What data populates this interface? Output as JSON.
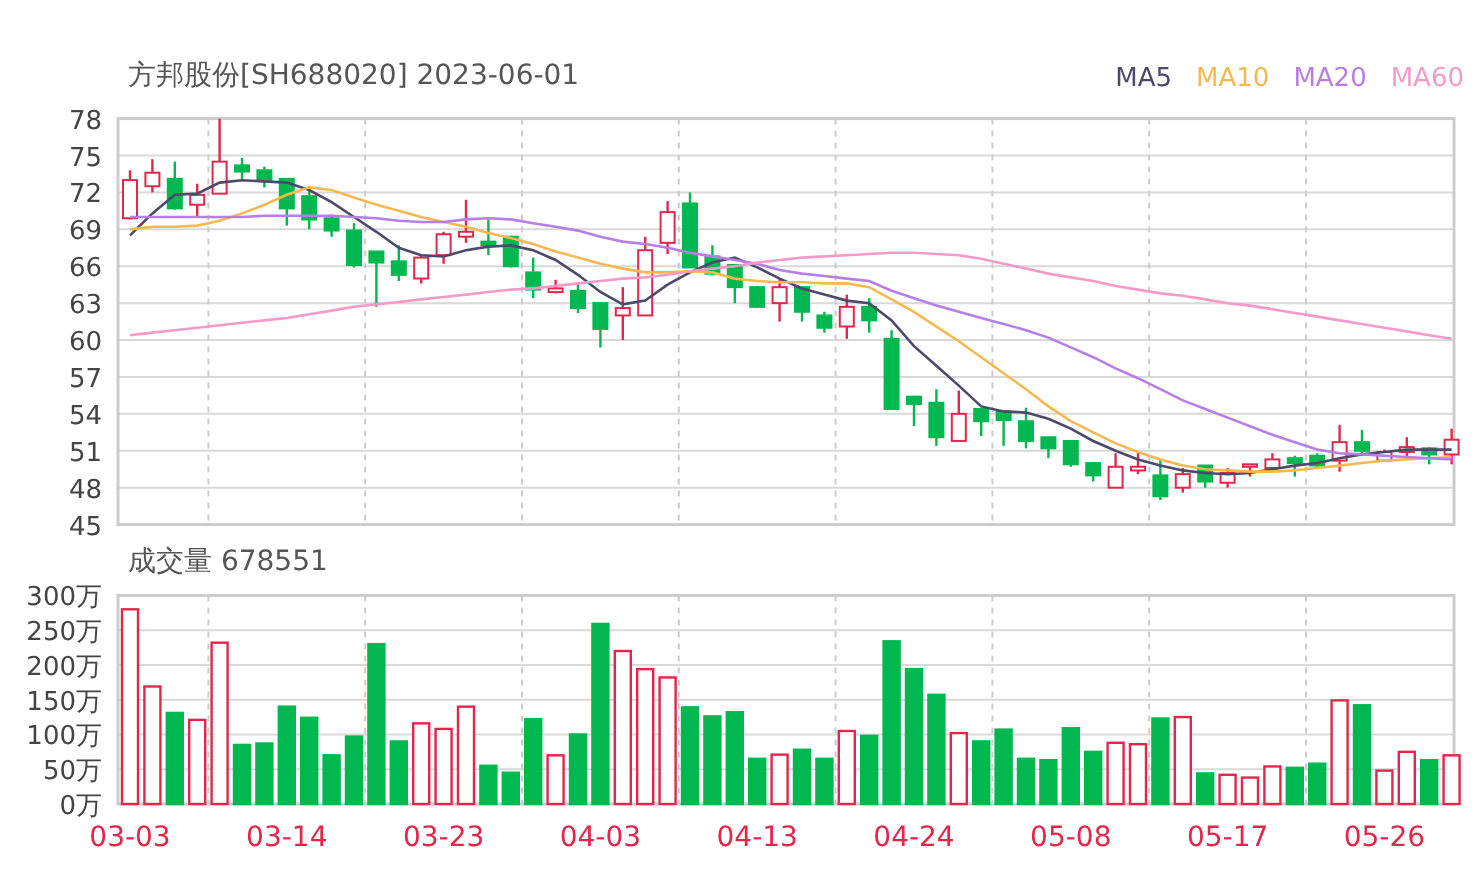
{
  "title": "方邦股份[SH688020] 2023-06-01",
  "price_chart": {
    "chart_data": {
      "type": "candlestick",
      "grid": true,
      "ylim": [
        45,
        78
      ],
      "yticks": [
        45,
        48,
        51,
        54,
        57,
        60,
        63,
        66,
        69,
        72,
        75,
        78
      ],
      "categories": [
        null,
        null,
        null,
        null,
        null,
        null,
        null,
        null,
        null,
        null,
        null,
        null,
        null,
        null,
        null,
        null,
        null,
        null,
        null,
        null,
        null,
        null,
        null,
        null,
        null,
        null,
        null,
        null,
        null,
        null,
        null,
        null,
        null,
        null,
        null,
        null,
        null,
        null,
        null,
        null,
        null,
        null,
        null,
        null,
        null,
        null,
        null,
        null,
        null,
        null,
        null,
        null,
        null,
        null,
        null,
        null,
        null,
        null,
        null,
        null
      ],
      "series": [
        {
          "name": "MA5",
          "type": "line",
          "color": "#4b4a6b",
          "values": [
            68.5,
            70.3,
            71.8,
            71.9,
            72.8,
            73.0,
            72.9,
            72.8,
            72.2,
            71.2,
            70.0,
            68.8,
            67.5,
            66.9,
            66.8,
            67.3,
            67.6,
            67.7,
            67.3,
            66.5,
            65.3,
            63.9,
            62.9,
            63.2,
            64.5,
            65.5,
            66.3,
            66.7,
            65.9,
            65.0,
            64.2,
            63.7,
            63.2,
            63.0,
            61.6,
            59.5,
            57.9,
            56.3,
            54.6,
            54.2,
            54.1,
            53.6,
            52.8,
            51.8,
            51.0,
            50.3,
            49.8,
            49.4,
            49.2,
            49.1,
            49.2,
            49.5,
            49.8,
            50.0,
            50.4,
            50.7,
            50.9,
            51.1,
            51.1,
            51.1
          ]
        },
        {
          "name": "MA10",
          "type": "line",
          "color": "#f5b94f",
          "values": [
            69.0,
            69.2,
            69.2,
            69.3,
            69.7,
            70.3,
            71.0,
            71.8,
            72.4,
            72.2,
            71.6,
            71.0,
            70.5,
            70.0,
            69.6,
            69.2,
            68.7,
            68.3,
            67.8,
            67.2,
            66.7,
            66.2,
            65.8,
            65.5,
            65.5,
            65.6,
            65.5,
            65.0,
            64.8,
            64.7,
            64.7,
            64.6,
            64.6,
            64.3,
            63.3,
            62.3,
            61.1,
            59.9,
            58.6,
            57.3,
            56.0,
            54.6,
            53.4,
            52.5,
            51.6,
            50.9,
            50.3,
            49.8,
            49.5,
            49.4,
            49.3,
            49.3,
            49.4,
            49.6,
            49.8,
            50.0,
            50.2,
            50.3,
            50.4,
            50.5
          ]
        },
        {
          "name": "MA20",
          "type": "line",
          "color": "#b77ee6",
          "values": [
            70.0,
            70.0,
            70.0,
            70.0,
            70.0,
            70.0,
            70.1,
            70.1,
            70.1,
            70.1,
            70.0,
            69.9,
            69.7,
            69.6,
            69.6,
            69.8,
            69.9,
            69.8,
            69.5,
            69.2,
            68.9,
            68.4,
            68.0,
            67.8,
            67.5,
            67.1,
            66.8,
            66.5,
            66.2,
            65.7,
            65.4,
            65.2,
            65.0,
            64.8,
            64.0,
            63.4,
            62.8,
            62.3,
            61.8,
            61.3,
            60.8,
            60.2,
            59.4,
            58.6,
            57.7,
            56.9,
            56.0,
            55.1,
            54.4,
            53.7,
            53.0,
            52.3,
            51.7,
            51.1,
            50.8,
            50.7,
            50.6,
            50.5,
            50.4,
            50.3
          ]
        },
        {
          "name": "MA60",
          "type": "line",
          "color": "#f59ac8",
          "values": [
            60.4,
            60.6,
            60.8,
            61.0,
            61.2,
            61.4,
            61.6,
            61.8,
            62.1,
            62.4,
            62.7,
            62.9,
            63.1,
            63.3,
            63.5,
            63.7,
            63.9,
            64.1,
            64.2,
            64.4,
            64.6,
            64.8,
            65.0,
            65.1,
            65.3,
            65.6,
            65.8,
            66.0,
            66.3,
            66.5,
            66.7,
            66.8,
            66.9,
            67.0,
            67.1,
            67.1,
            67.0,
            66.9,
            66.6,
            66.2,
            65.8,
            65.4,
            65.1,
            64.8,
            64.4,
            64.1,
            63.8,
            63.6,
            63.3,
            63.0,
            62.8,
            62.5,
            62.2,
            61.9,
            61.6,
            61.3,
            61.0,
            60.7,
            60.4,
            60.1
          ]
        }
      ],
      "ohlc": [
        [
          69.9,
          73.8,
          69.8,
          73.0
        ],
        [
          72.5,
          74.7,
          72.0,
          73.6
        ],
        [
          73.1,
          74.5,
          70.6,
          70.7
        ],
        [
          71.0,
          72.7,
          70.0,
          71.8
        ],
        [
          71.9,
          78.0,
          71.9,
          74.5
        ],
        [
          74.2,
          74.8,
          73.1,
          73.7
        ],
        [
          73.8,
          74.1,
          72.4,
          73.0
        ],
        [
          73.1,
          73.1,
          69.3,
          70.7
        ],
        [
          71.7,
          72.2,
          69.0,
          69.8
        ],
        [
          69.9,
          70.2,
          68.4,
          68.9
        ],
        [
          68.9,
          69.5,
          65.9,
          66.1
        ],
        [
          67.2,
          67.2,
          62.7,
          66.3
        ],
        [
          66.4,
          67.7,
          64.8,
          65.3
        ],
        [
          65.0,
          66.9,
          64.6,
          66.7
        ],
        [
          66.9,
          68.8,
          66.2,
          68.6
        ],
        [
          68.4,
          71.4,
          67.9,
          68.8
        ],
        [
          68.0,
          69.8,
          66.9,
          67.7
        ],
        [
          68.4,
          68.4,
          65.9,
          66.0
        ],
        [
          65.5,
          66.7,
          63.4,
          64.1
        ],
        [
          63.9,
          64.9,
          63.8,
          64.2
        ],
        [
          64.0,
          64.6,
          62.2,
          62.6
        ],
        [
          63.0,
          63.0,
          59.4,
          60.9
        ],
        [
          62.0,
          64.3,
          60.0,
          62.6
        ],
        [
          62.0,
          68.4,
          62.0,
          67.3
        ],
        [
          67.9,
          71.3,
          67.0,
          70.4
        ],
        [
          71.1,
          72.0,
          65.9,
          65.9
        ],
        [
          66.8,
          67.7,
          65.3,
          65.4
        ],
        [
          66.1,
          66.1,
          63.0,
          64.3
        ],
        [
          64.3,
          64.4,
          62.6,
          62.7
        ],
        [
          63.0,
          65.0,
          61.5,
          64.3
        ],
        [
          64.3,
          64.3,
          61.5,
          62.3
        ],
        [
          62.0,
          62.3,
          60.6,
          61.0
        ],
        [
          61.1,
          63.7,
          60.1,
          62.7
        ],
        [
          62.7,
          63.4,
          60.6,
          61.6
        ],
        [
          60.1,
          60.8,
          54.4,
          54.4
        ],
        [
          55.4,
          55.4,
          53.0,
          54.8
        ],
        [
          54.9,
          56.0,
          51.4,
          52.1
        ],
        [
          51.8,
          55.9,
          51.8,
          54.0
        ],
        [
          54.4,
          54.4,
          52.2,
          53.4
        ],
        [
          54.2,
          54.2,
          51.4,
          53.5
        ],
        [
          53.4,
          54.5,
          51.2,
          51.8
        ],
        [
          52.1,
          52.1,
          50.4,
          51.2
        ],
        [
          51.8,
          51.8,
          49.7,
          49.9
        ],
        [
          50.0,
          50.0,
          48.5,
          49.0
        ],
        [
          48.0,
          50.8,
          48.0,
          49.7
        ],
        [
          49.4,
          50.9,
          49.1,
          49.7
        ],
        [
          49.0,
          50.3,
          47.0,
          47.3
        ],
        [
          48.0,
          49.6,
          47.6,
          49.1
        ],
        [
          49.8,
          49.8,
          48.0,
          48.5
        ],
        [
          48.4,
          49.6,
          48.0,
          49.2
        ],
        [
          49.7,
          49.9,
          48.9,
          49.9
        ],
        [
          49.6,
          50.8,
          49.5,
          50.3
        ],
        [
          50.4,
          50.6,
          48.9,
          50.0
        ],
        [
          50.6,
          50.8,
          49.7,
          49.8
        ],
        [
          50.2,
          53.1,
          49.3,
          51.7
        ],
        [
          51.7,
          52.7,
          50.6,
          51.0
        ],
        [
          50.2,
          51.1,
          50.1,
          50.9
        ],
        [
          50.9,
          52.1,
          50.4,
          51.3
        ],
        [
          51.2,
          51.3,
          49.9,
          50.7
        ],
        [
          50.7,
          52.8,
          49.9,
          51.9
        ]
      ]
    }
  },
  "volume_chart": {
    "label": "成交量 678551",
    "chart_data": {
      "type": "bar",
      "grid": true,
      "ylim": [
        0,
        300
      ],
      "yticks": [
        {
          "value": 0,
          "label": "0万"
        },
        {
          "value": 50,
          "label": "50万"
        },
        {
          "value": 100,
          "label": "100万"
        },
        {
          "value": 150,
          "label": "150万"
        },
        {
          "value": 200,
          "label": "200万"
        },
        {
          "value": 250,
          "label": "250万"
        },
        {
          "value": 300,
          "label": "300万"
        }
      ],
      "categories": [
        "03-03",
        null,
        null,
        null,
        null,
        null,
        null,
        "03-14",
        null,
        null,
        null,
        null,
        null,
        null,
        "03-23",
        null,
        null,
        null,
        null,
        null,
        null,
        "04-03",
        null,
        null,
        null,
        null,
        null,
        null,
        "04-13",
        null,
        null,
        null,
        null,
        null,
        null,
        "04-24",
        null,
        null,
        null,
        null,
        null,
        null,
        "05-08",
        null,
        null,
        null,
        null,
        null,
        null,
        "05-17",
        null,
        null,
        null,
        null,
        null,
        null,
        "05-26",
        null,
        null,
        null
      ],
      "values": [
        280,
        169,
        131,
        121,
        232,
        85,
        87,
        140,
        124,
        70,
        97,
        230,
        90,
        116,
        108,
        140,
        55,
        45,
        122,
        70,
        100,
        259,
        220,
        194,
        182,
        139,
        126,
        132,
        65,
        71,
        78,
        65,
        105,
        98,
        234,
        194,
        157,
        102,
        90,
        107,
        65,
        63,
        109,
        75,
        88,
        86,
        123,
        125,
        44,
        42,
        38,
        54,
        52,
        58,
        149,
        142,
        48,
        75,
        63,
        70
      ]
    }
  }
}
